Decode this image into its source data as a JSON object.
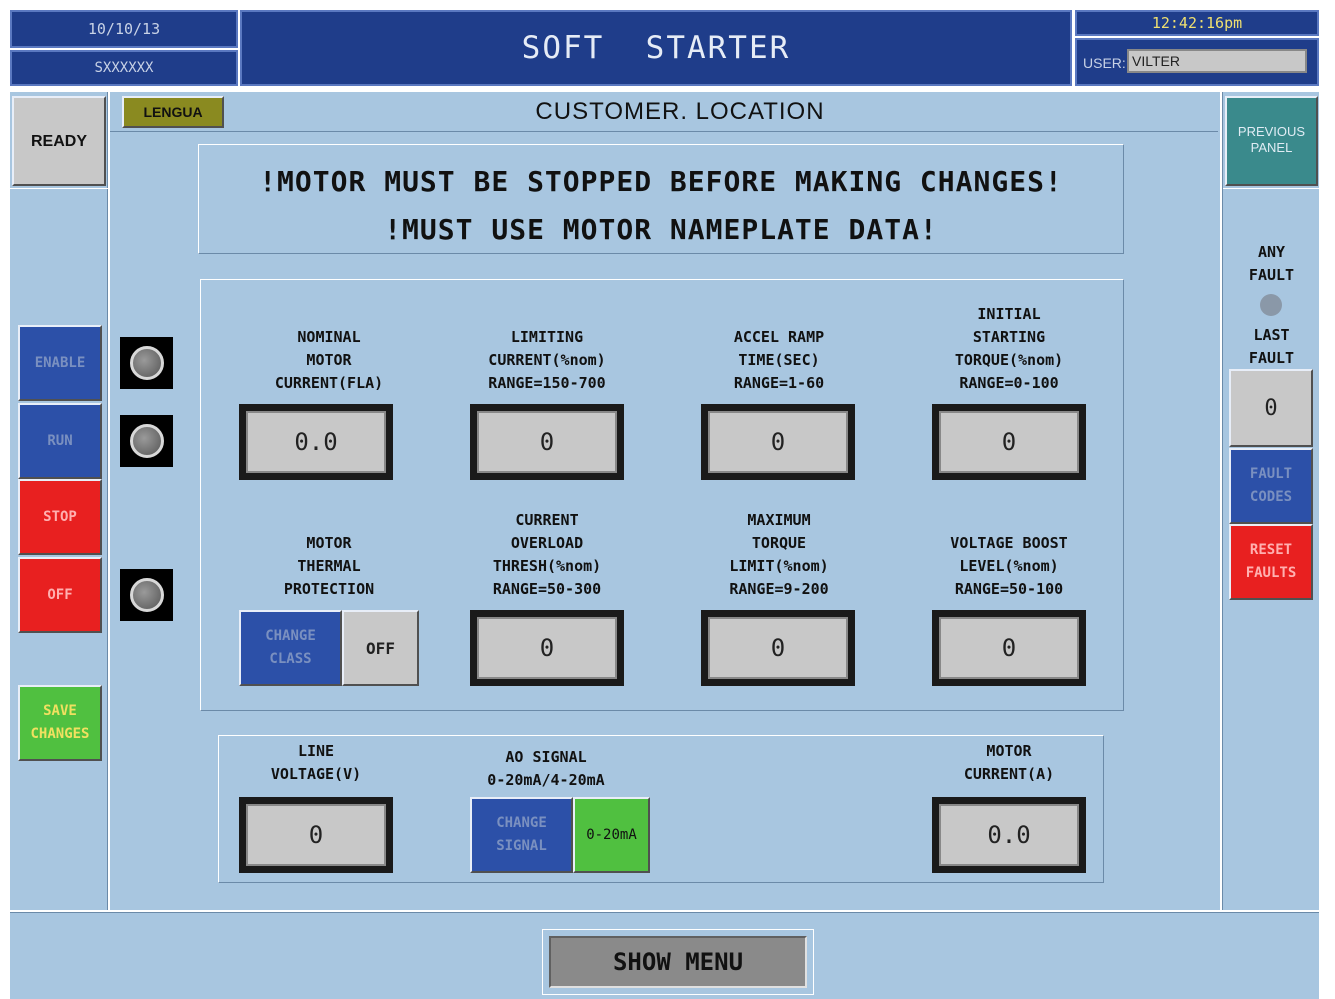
{
  "header": {
    "date": "10/10/13",
    "serial": "SXXXXXX",
    "title": "SOFT  STARTER",
    "time": "12:42:16pm",
    "user_label": "USER:",
    "user_value": "VILTER"
  },
  "location": {
    "language_button": "LENGUA",
    "title": "CUSTOMER. LOCATION"
  },
  "left_nav": {
    "status": "READY",
    "enable": "ENABLE",
    "run": "RUN",
    "stop": "STOP",
    "off": "OFF",
    "save": "SAVE\nCHANGES"
  },
  "right_nav": {
    "previous_panel": "PREVIOUS\nPANEL",
    "any_fault": "ANY\nFAULT",
    "last_fault": "LAST\nFAULT",
    "last_fault_value": "0",
    "fault_codes": "FAULT\nCODES",
    "reset_faults": "RESET\nFAULTS"
  },
  "warnings": {
    "line1": "!MOTOR MUST BE STOPPED BEFORE MAKING CHANGES!",
    "line2": "!MUST USE MOTOR NAMEPLATE DATA!"
  },
  "params": {
    "nominal_current": {
      "label": "NOMINAL\nMOTOR\nCURRENT(FLA)",
      "value": "0.0"
    },
    "limiting_current": {
      "label": "LIMITING\nCURRENT(%nom)\nRANGE=150-700",
      "value": "0"
    },
    "accel_ramp": {
      "label": "ACCEL RAMP\nTIME(SEC)\nRANGE=1-60",
      "value": "0"
    },
    "initial_torque": {
      "label": "INITIAL\nSTARTING\nTORQUE(%nom)\nRANGE=0-100",
      "value": "0"
    },
    "thermal_protection": {
      "label": "MOTOR\nTHERMAL\nPROTECTION",
      "change_label": "CHANGE\nCLASS",
      "value": "OFF"
    },
    "overload_thresh": {
      "label": "CURRENT\nOVERLOAD\nTHRESH(%nom)\nRANGE=50-300",
      "value": "0"
    },
    "max_torque": {
      "label": "MAXIMUM\nTORQUE\nLIMIT(%nom)\nRANGE=9-200",
      "value": "0"
    },
    "voltage_boost": {
      "label": "VOLTAGE BOOST\nLEVEL(%nom)\nRANGE=50-100",
      "value": "0"
    }
  },
  "readings": {
    "line_voltage": {
      "label": "LINE\nVOLTAGE(V)",
      "value": "0"
    },
    "ao_signal": {
      "label": "AO SIGNAL\n0-20mA/4-20mA",
      "change_label": "CHANGE\nSIGNAL",
      "value": "0-20mA"
    },
    "motor_current": {
      "label": "MOTOR\nCURRENT(A)",
      "value": "0.0"
    }
  },
  "footer": {
    "show_menu": "SHOW MENU"
  }
}
